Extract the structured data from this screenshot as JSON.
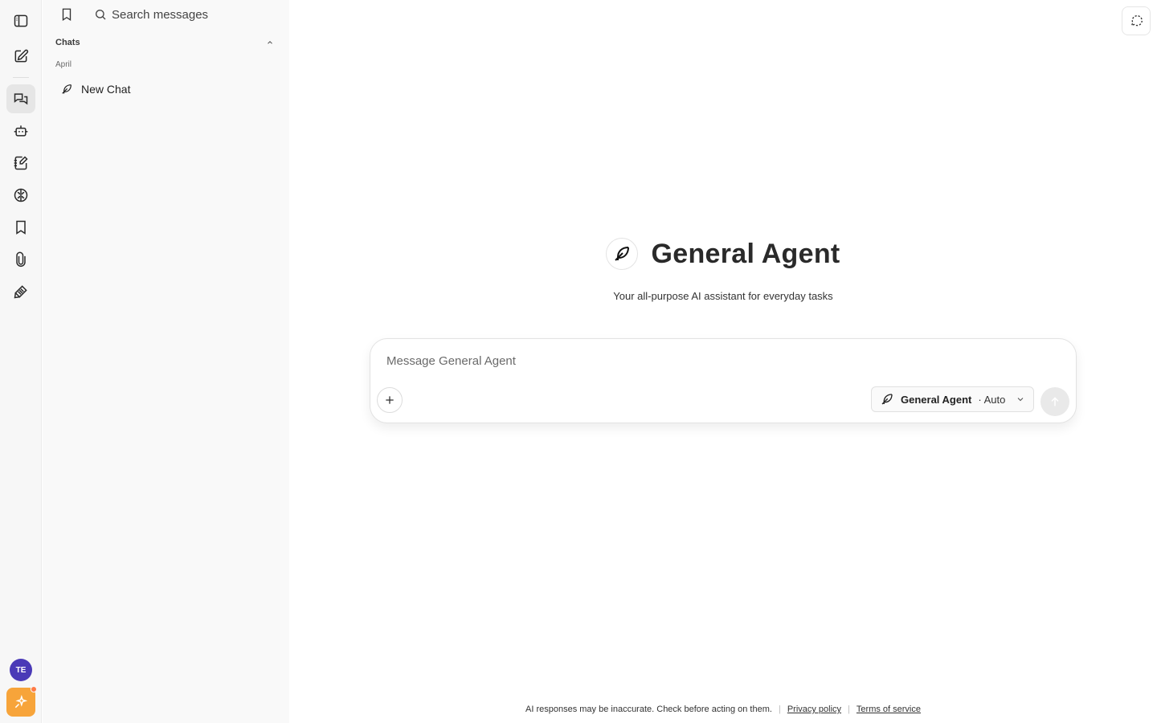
{
  "sidebar": {
    "search_placeholder": "Search messages",
    "section_title": "Chats",
    "group_label": "April",
    "chats": [
      {
        "label": "New Chat"
      }
    ]
  },
  "rail": {
    "avatar_initials": "TE",
    "items": [
      {
        "icon": "sidebar-toggle-icon"
      },
      {
        "icon": "new-chat-icon"
      },
      {
        "icon": "chats-icon",
        "active": true
      },
      {
        "icon": "robot-icon"
      },
      {
        "icon": "notebook-icon"
      },
      {
        "icon": "brain-icon"
      },
      {
        "icon": "bookmark-icon"
      },
      {
        "icon": "paperclip-icon"
      },
      {
        "icon": "prompt-icon"
      }
    ]
  },
  "main": {
    "title": "General Agent",
    "subtitle": "Your all-purpose AI assistant for everyday tasks",
    "composer": {
      "placeholder": "Message General Agent",
      "agent_name": "General Agent",
      "agent_mode": "· Auto"
    },
    "footer": {
      "disclaimer": "AI responses may be inaccurate. Check before acting on them.",
      "privacy": "Privacy policy",
      "terms": "Terms of service"
    }
  },
  "colors": {
    "accent_avatar": "#4a3ab7",
    "upgrade": "#f7a43a"
  }
}
